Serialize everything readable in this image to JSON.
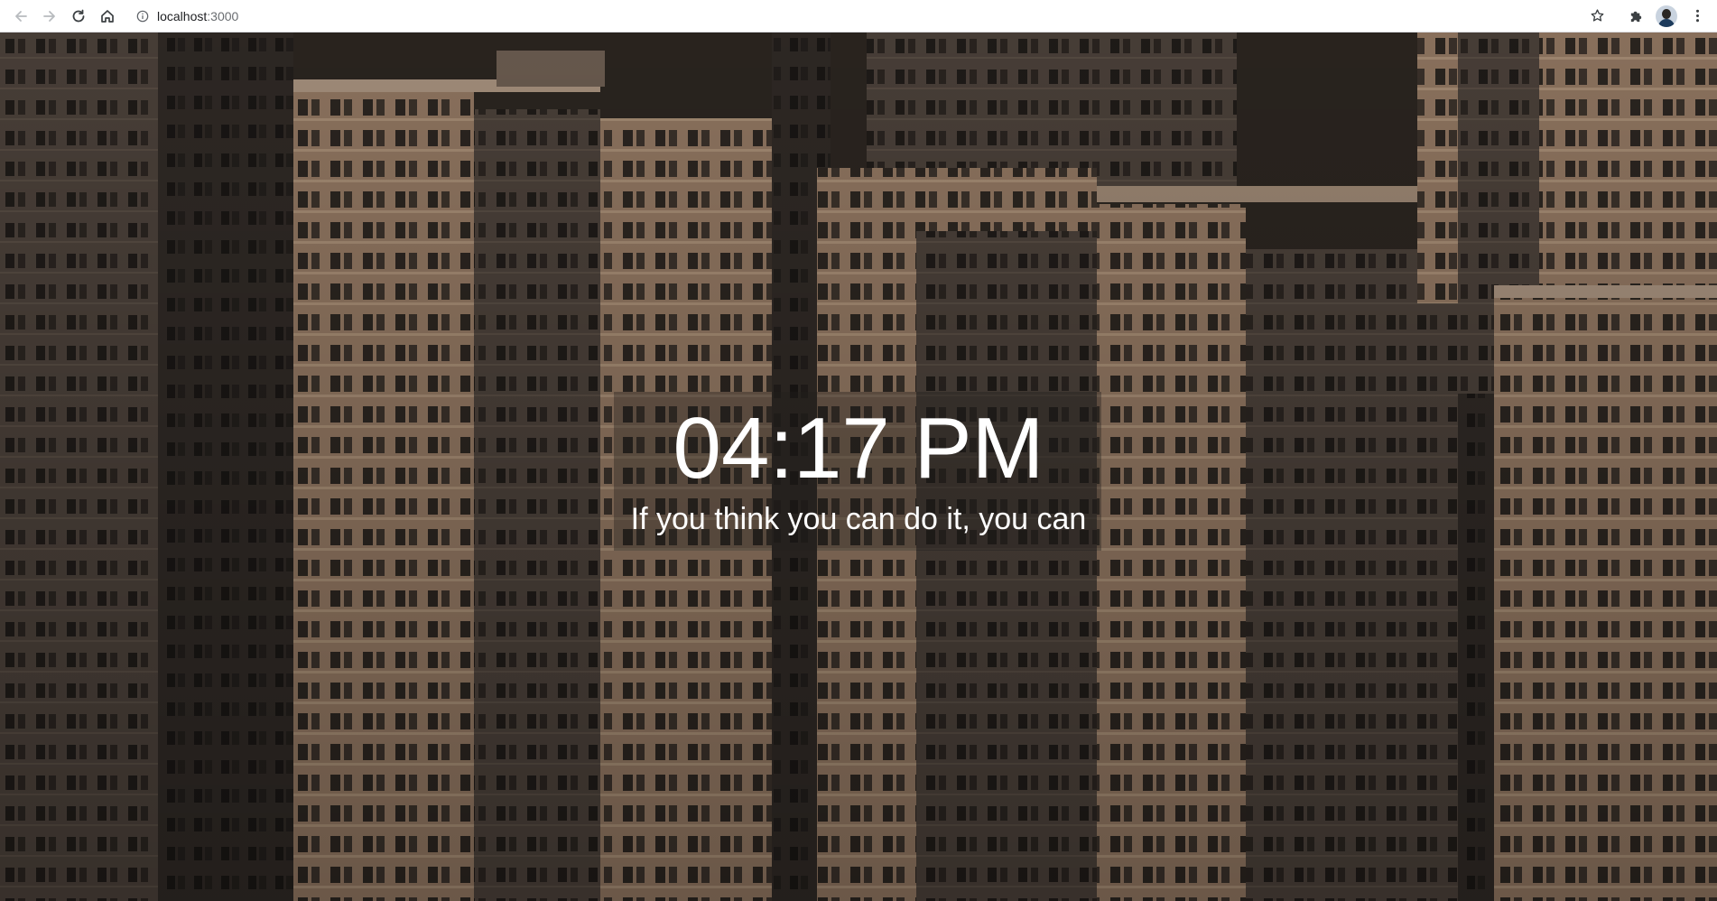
{
  "browser": {
    "url_host": "localhost",
    "url_port": ":3000",
    "icons": {
      "back": "arrow-left-icon",
      "forward": "arrow-right-icon",
      "reload": "reload-icon",
      "home": "home-icon",
      "info": "info-icon",
      "bookmark": "star-icon",
      "extensions": "puzzle-icon",
      "profile": "avatar",
      "menu": "kebab-menu-icon"
    }
  },
  "page": {
    "background": "city apartment buildings photo",
    "clock": {
      "time": "04:17 PM",
      "quote": "If you think you can do it, you can"
    }
  },
  "colors": {
    "text": "#ffffff",
    "building_warm": "#9c826a",
    "building_shadow": "#3b332c"
  }
}
